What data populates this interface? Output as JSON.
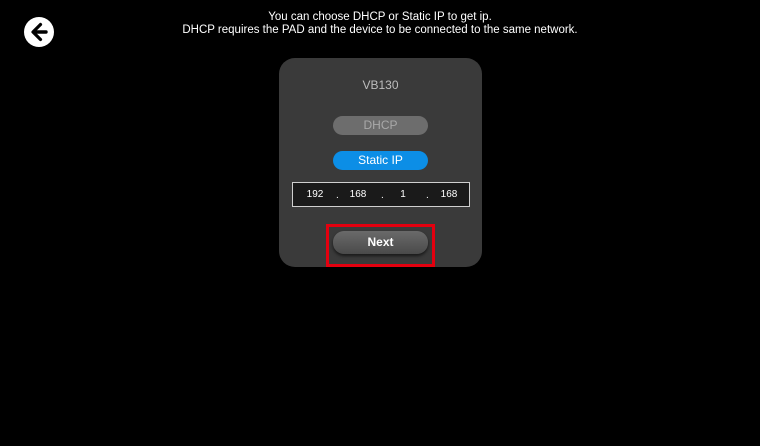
{
  "header": {
    "instruction_line1": "You can choose DHCP or Static IP to get ip.",
    "instruction_line2": "DHCP requires the PAD and the device to be connected to the same network.",
    "back_icon": "arrow-left-circle-icon"
  },
  "panel": {
    "device_name": "VB130",
    "dhcp_label": "DHCP",
    "static_ip_label": "Static IP",
    "selected_mode": "Static IP",
    "ip": {
      "octet1": "192",
      "octet2": "168",
      "octet3": "1",
      "octet4": "168"
    },
    "next_label": "Next"
  },
  "colors": {
    "background": "#000000",
    "panel": "#3a3a3a",
    "accent": "#0c8ee6",
    "highlight": "#e4000f"
  }
}
